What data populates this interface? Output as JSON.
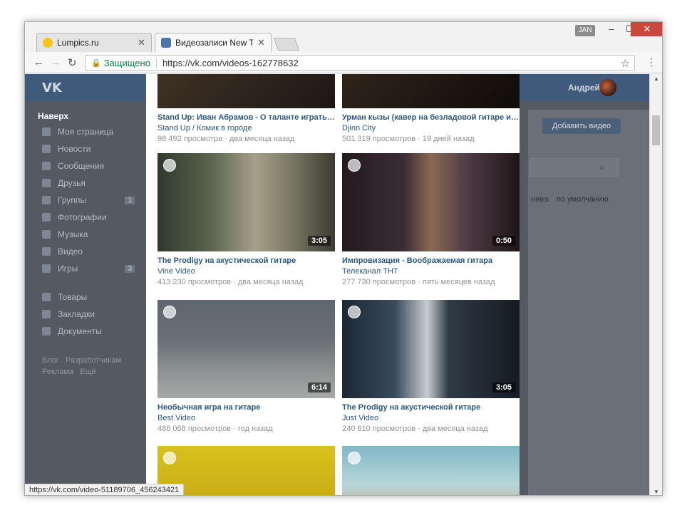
{
  "browser": {
    "tabs": [
      {
        "title": "Lumpics.ru",
        "favicon_color": "#f5c518"
      },
      {
        "title": "Видеозаписи New Two",
        "favicon_color": "#4a76a8"
      }
    ],
    "user_badge": "JAN",
    "secure_label": "Защищено",
    "url": "https://vk.com/videos-162778632",
    "status_url": "https://vk.com/video-51189706_456243421"
  },
  "vk": {
    "logo": "VK",
    "user_name": "Андрей",
    "back_to_top": "Наверх",
    "sidebar": [
      {
        "label": "Моя страница",
        "count": ""
      },
      {
        "label": "Новости",
        "count": ""
      },
      {
        "label": "Сообщения",
        "count": ""
      },
      {
        "label": "Друзья",
        "count": ""
      },
      {
        "label": "Группы",
        "count": "1"
      },
      {
        "label": "Фотографии",
        "count": ""
      },
      {
        "label": "Музыка",
        "count": ""
      },
      {
        "label": "Видео",
        "count": ""
      },
      {
        "label": "Игры",
        "count": "3"
      },
      {
        "label": "Товары",
        "count": ""
      },
      {
        "label": "Закладки",
        "count": ""
      },
      {
        "label": "Документы",
        "count": ""
      }
    ],
    "footer_links": [
      "Блог",
      "Разработчикам",
      "Реклама",
      "Ещё"
    ],
    "add_video": "Добавить видео",
    "sort_prefix": "ниеа",
    "sort_value": "по умолчанию"
  },
  "videos": [
    {
      "title": "Stand Up: Иван Абрамов - О таланте играть на г...",
      "channel": "Stand Up / Комик в городе",
      "views": "98 492 просмотра",
      "date": "два месяца назад",
      "duration": ""
    },
    {
      "title": "Урман кызы (кавер на безладовой гитаре и Ко...",
      "channel": "Djinn City",
      "views": "501 319 просмотров",
      "date": "19 дней назад",
      "duration": ""
    },
    {
      "title": "The Prodigy на акустической гитаре",
      "channel": "Vine Video",
      "views": "413 230 просмотров",
      "date": "два месяца назад",
      "duration": "3:05"
    },
    {
      "title": "Импровизация - Воображаемая гитара",
      "channel": "Телеканал ТНТ",
      "views": "277 730 просмотров",
      "date": "пять месяцев назад",
      "duration": "0:50"
    },
    {
      "title": "Необычная игра на гитаре",
      "channel": "Best Video",
      "views": "486 068 просмотров",
      "date": "год назад",
      "duration": "6:14"
    },
    {
      "title": "The Prodigy на акустической гитаре",
      "channel": "Just Video",
      "views": "240 810 просмотров",
      "date": "два месяца назад",
      "duration": "3:05"
    }
  ]
}
